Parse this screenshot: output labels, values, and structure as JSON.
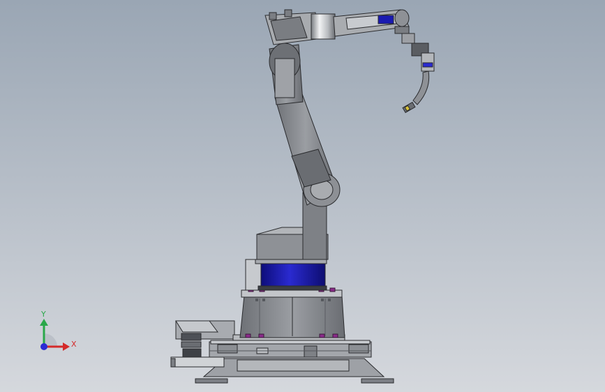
{
  "viewport": {
    "background_top": "#9aa6b4",
    "background_bottom": "#d5d8dd"
  },
  "triad": {
    "x_label": "X",
    "y_label": "Y",
    "x_color": "#d42a2a",
    "y_color": "#2aa84a",
    "z_color": "#2a2ad4"
  },
  "model": {
    "body_color": "#8a8d92",
    "dark_color": "#5d6066",
    "light_color": "#c9ccd0",
    "accent_color": "#1a1ab0",
    "bolt_color": "#8a2a8a"
  }
}
